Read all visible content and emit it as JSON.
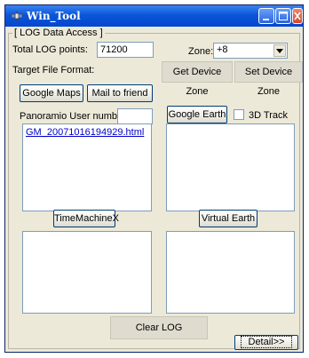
{
  "window": {
    "title": "Win_Tool"
  },
  "group": {
    "label": "[ LOG Data Access ]"
  },
  "log": {
    "total_label": "Total LOG points:",
    "total_value": "71200"
  },
  "zone": {
    "label": "Zone:",
    "value": "+8"
  },
  "format": {
    "label": "Target File Format:"
  },
  "buttons": {
    "get_zone": "Get Device Zone",
    "set_zone": "Set Device Zone",
    "google_maps": "Google Maps",
    "mail_friend": "Mail to friend",
    "google_earth": "Google Earth",
    "time_machine": "TimeMachineX",
    "virtual_earth": "Virtual Earth",
    "clear_log": "Clear LOG",
    "detail": "Detail>>"
  },
  "panoramio": {
    "label": "Panoramio User number",
    "value": ""
  },
  "track3d": {
    "label": "3D Track",
    "checked": false
  },
  "lists": {
    "google_maps_files": [
      "GM_20071016194929.html"
    ]
  },
  "icons": {
    "app": "satellite-icon",
    "minimize": "minimize-icon",
    "maximize": "maximize-icon",
    "close": "close-icon",
    "dropdown": "chevron-down-icon"
  },
  "colors": {
    "titlebar": "#0a56d8",
    "window_bg": "#ece9d8",
    "link": "#0000cc"
  }
}
